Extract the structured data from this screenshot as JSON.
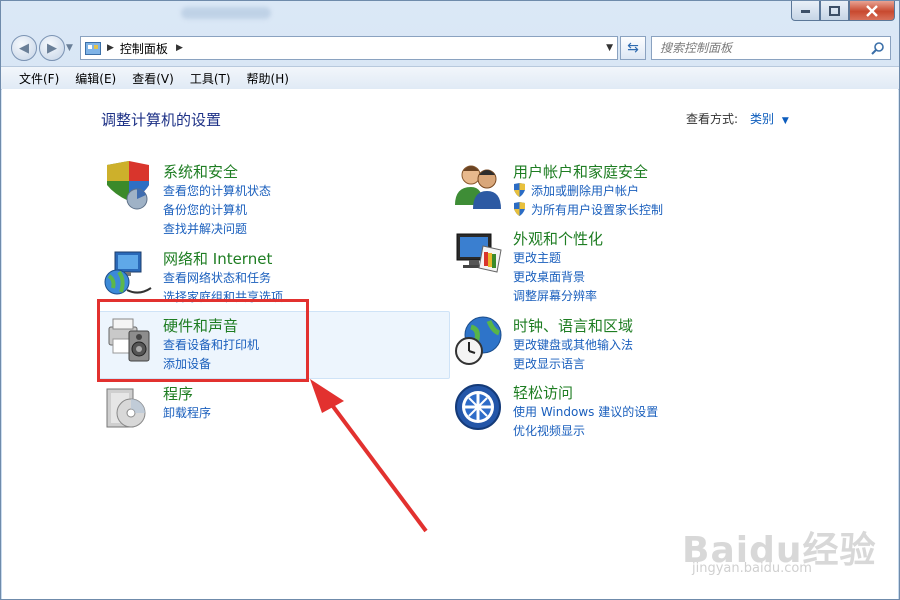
{
  "window": {
    "title_blurred": ""
  },
  "address_bar": {
    "path": "控制面板",
    "search_placeholder": "搜索控制面板"
  },
  "menu": [
    "文件(F)",
    "编辑(E)",
    "查看(V)",
    "工具(T)",
    "帮助(H)"
  ],
  "main": {
    "heading": "调整计算机的设置",
    "view_by_label": "查看方式:",
    "view_by_value": "类别"
  },
  "categories_left": [
    {
      "title": "系统和安全",
      "icon": "security-shield-icon",
      "links": [
        "查看您的计算机状态",
        "备份您的计算机",
        "查找并解决问题"
      ]
    },
    {
      "title": "网络和 Internet",
      "icon": "network-globe-icon",
      "links": [
        "查看网络状态和任务",
        "选择家庭组和共享选项"
      ]
    },
    {
      "title": "硬件和声音",
      "icon": "printer-speaker-icon",
      "links": [
        "查看设备和打印机",
        "添加设备"
      ]
    },
    {
      "title": "程序",
      "icon": "programs-disc-icon",
      "links": [
        "卸载程序"
      ]
    }
  ],
  "categories_right": [
    {
      "title": "用户帐户和家庭安全",
      "icon": "users-icon",
      "links": [
        "添加或删除用户帐户",
        "为所有用户设置家长控制"
      ]
    },
    {
      "title": "外观和个性化",
      "icon": "monitor-palette-icon",
      "links": [
        "更改主题",
        "更改桌面背景",
        "调整屏幕分辨率"
      ]
    },
    {
      "title": "时钟、语言和区域",
      "icon": "clock-globe-icon",
      "links": [
        "更改键盘或其他输入法",
        "更改显示语言"
      ]
    },
    {
      "title": "轻松访问",
      "icon": "ease-of-access-icon",
      "links": [
        "使用 Windows 建议的设置",
        "优化视频显示"
      ]
    }
  ],
  "watermark": {
    "brand": "Baidu经验",
    "url": "jingyan.baidu.com"
  },
  "colors": {
    "title_green": "#1e7d22",
    "link_blue": "#1a5fbd",
    "highlight_red": "#e2312f"
  }
}
